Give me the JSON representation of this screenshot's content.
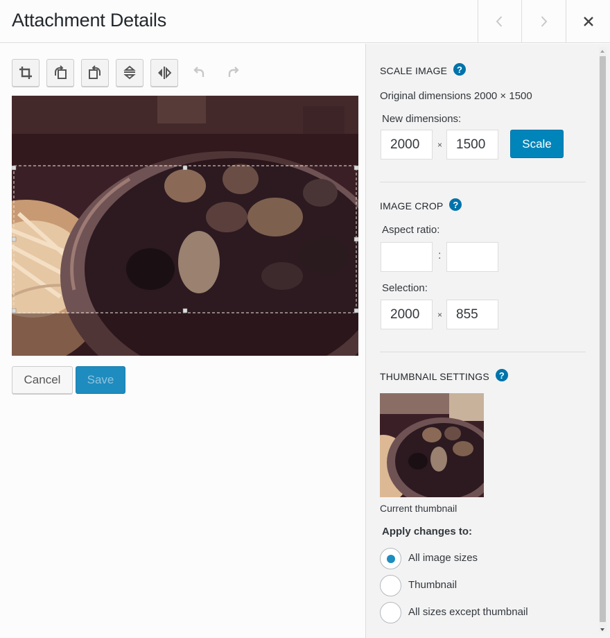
{
  "header": {
    "title": "Attachment Details",
    "prev_icon": "chevron-left-icon",
    "next_icon": "chevron-right-icon",
    "close_icon": "close-icon"
  },
  "toolbar": {
    "tools": [
      "crop-icon",
      "rotate-left-icon",
      "rotate-right-icon",
      "flip-vertical-icon",
      "flip-horizontal-icon",
      "undo-icon",
      "redo-icon"
    ]
  },
  "editor": {
    "cancel_label": "Cancel",
    "save_label": "Save",
    "selection_fraction": {
      "top": 0.268,
      "height": 0.57
    }
  },
  "scale_image": {
    "heading": "Scale Image",
    "original": "Original dimensions 2000 × 1500",
    "new_label": "New dimensions:",
    "width": "2000",
    "height": "1500",
    "separator": "×",
    "button": "Scale"
  },
  "image_crop": {
    "heading": "Image Crop",
    "aspect_label": "Aspect ratio:",
    "aspect_w": "",
    "aspect_h": "",
    "aspect_sep": ":",
    "selection_label": "Selection:",
    "sel_w": "2000",
    "sel_h": "855",
    "separator": "×"
  },
  "thumbnail": {
    "heading": "Thumbnail Settings",
    "caption": "Current thumbnail",
    "apply_label": "Apply changes to:",
    "options": [
      {
        "label": "All image sizes",
        "checked": true
      },
      {
        "label": "Thumbnail",
        "checked": false
      },
      {
        "label": "All sizes except thumbnail",
        "checked": false
      }
    ]
  },
  "colors": {
    "accent": "#0085ba",
    "help": "#0073aa"
  }
}
